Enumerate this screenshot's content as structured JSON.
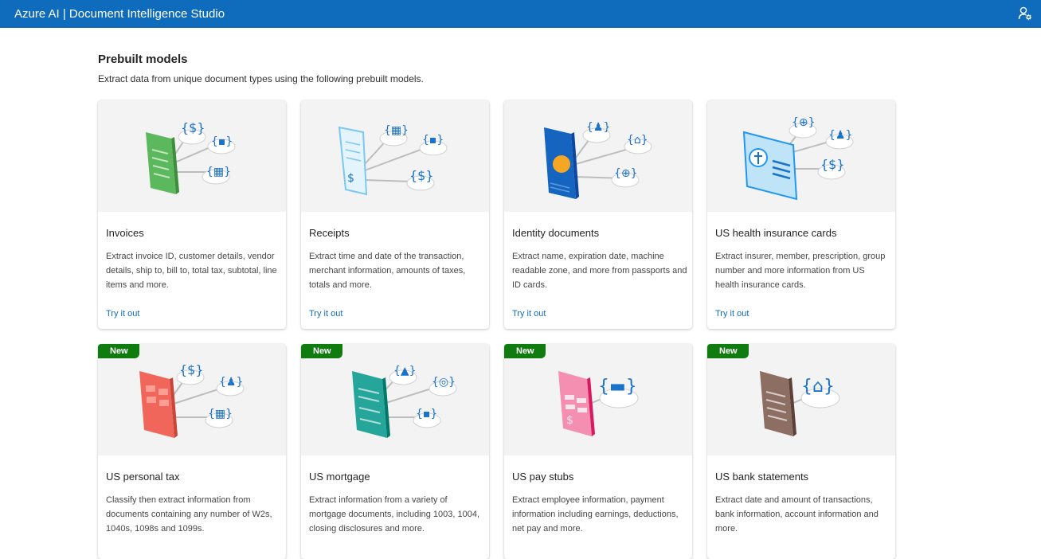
{
  "header": {
    "title": "Azure AI | Document Intelligence Studio",
    "account_icon": "person-settings-icon"
  },
  "section": {
    "title": "Prebuilt models",
    "subtitle": "Extract data from unique document types using the following prebuilt models."
  },
  "colors": {
    "header_bg": "#0f6cbd",
    "link": "#0f6cbd",
    "new_badge": "#107c10"
  },
  "cards": [
    {
      "title": "Invoices",
      "description": "Extract invoice ID, customer details, vendor details, ship to, bill to, total tax, subtotal, line items and more.",
      "link": "Try it out",
      "badge": "",
      "icon": "invoice-illustration-icon"
    },
    {
      "title": "Receipts",
      "description": "Extract time and date of the transaction, merchant information, amounts of taxes, totals and more.",
      "link": "Try it out",
      "badge": "",
      "icon": "receipt-illustration-icon"
    },
    {
      "title": "Identity documents",
      "description": "Extract name, expiration date, machine readable zone, and more from passports and ID cards.",
      "link": "Try it out",
      "badge": "",
      "icon": "passport-illustration-icon"
    },
    {
      "title": "US health insurance cards",
      "description": "Extract insurer, member, prescription, group number and more information from US health insurance cards.",
      "link": "Try it out",
      "badge": "",
      "icon": "health-card-illustration-icon"
    },
    {
      "title": "US personal tax",
      "description": "Classify then extract information from documents containing any number of W2s, 1040s, 1098s and 1099s.",
      "link": "",
      "badge": "New",
      "icon": "tax-form-illustration-icon"
    },
    {
      "title": "US mortgage",
      "description": "Extract information from a variety of mortgage documents, including 1003, 1004, closing disclosures and more.",
      "link": "",
      "badge": "New",
      "icon": "mortgage-illustration-icon"
    },
    {
      "title": "US pay stubs",
      "description": "Extract employee information, payment information including earnings, deductions, net pay and more.",
      "link": "",
      "badge": "New",
      "icon": "paystub-illustration-icon"
    },
    {
      "title": "US bank statements",
      "description": "Extract date and amount of transactions, bank information, account information and more.",
      "link": "",
      "badge": "New",
      "icon": "bank-statement-illustration-icon"
    }
  ]
}
